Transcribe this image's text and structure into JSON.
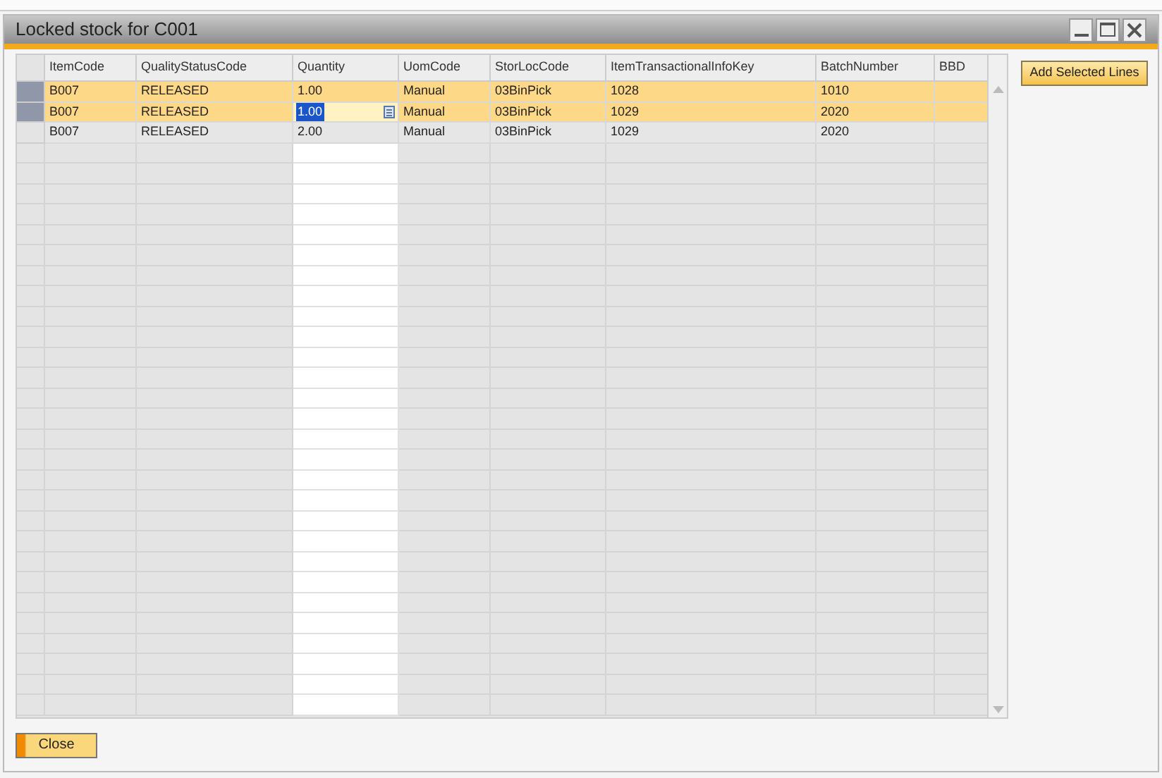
{
  "window": {
    "title": "Locked stock for C001"
  },
  "table": {
    "columns": [
      "ItemCode",
      "QualityStatusCode",
      "Quantity",
      "UomCode",
      "StorLocCode",
      "ItemTransactionalInfoKey",
      "BatchNumber",
      "BBD"
    ],
    "rows": [
      {
        "selected": true,
        "editing": false,
        "cells": [
          "B007",
          "RELEASED",
          "1.00",
          "Manual",
          "03BinPick",
          "1028",
          "1010",
          ""
        ]
      },
      {
        "selected": true,
        "editing": true,
        "cells": [
          "B007",
          "RELEASED",
          "1.00",
          "Manual",
          "03BinPick",
          "1029",
          "2020",
          ""
        ]
      },
      {
        "selected": false,
        "editing": false,
        "cells": [
          "B007",
          "RELEASED",
          "2.00",
          "Manual",
          "03BinPick",
          "1029",
          "2020",
          ""
        ]
      }
    ]
  },
  "buttons": {
    "add": "Add Selected Lines",
    "close": "Close"
  }
}
